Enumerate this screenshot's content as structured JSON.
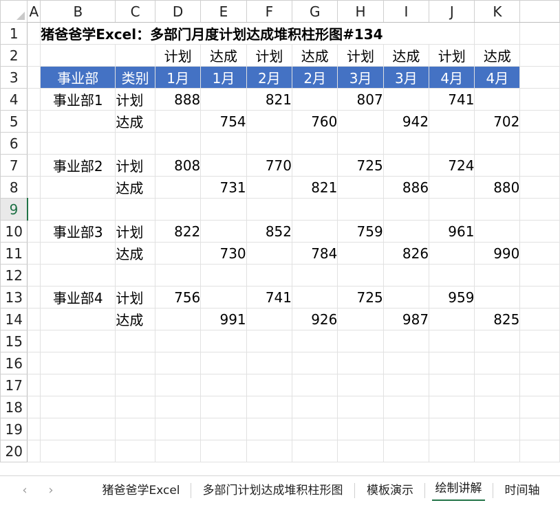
{
  "sheet": {
    "columns": [
      "A",
      "B",
      "C",
      "D",
      "E",
      "F",
      "G",
      "H",
      "I",
      "J",
      "K"
    ],
    "rows": [
      "1",
      "2",
      "3",
      "4",
      "5",
      "6",
      "7",
      "8",
      "9",
      "10",
      "11",
      "12",
      "13",
      "14",
      "15",
      "16",
      "17",
      "18",
      "19",
      "20"
    ],
    "active_row": "9",
    "title": "猪爸爸学Excel：多部门月度计划达成堆积柱形图#134",
    "row2": [
      "计划",
      "达成",
      "计划",
      "达成",
      "计划",
      "达成",
      "计划",
      "达成"
    ],
    "header_row": [
      "事业部",
      "类别",
      "1月",
      "1月",
      "2月",
      "2月",
      "3月",
      "3月",
      "4月",
      "4月"
    ],
    "departments": [
      {
        "name": "事业部1",
        "plan_label": "计划",
        "actual_label": "达成",
        "plan": [
          "888",
          "",
          "821",
          "",
          "807",
          "",
          "741",
          ""
        ],
        "actual": [
          "",
          "754",
          "",
          "760",
          "",
          "942",
          "",
          "702"
        ]
      },
      {
        "name": "事业部2",
        "plan_label": "计划",
        "actual_label": "达成",
        "plan": [
          "808",
          "",
          "770",
          "",
          "725",
          "",
          "724",
          ""
        ],
        "actual": [
          "",
          "731",
          "",
          "821",
          "",
          "886",
          "",
          "880"
        ]
      },
      {
        "name": "事业部3",
        "plan_label": "计划",
        "actual_label": "达成",
        "plan": [
          "822",
          "",
          "852",
          "",
          "759",
          "",
          "961",
          ""
        ],
        "actual": [
          "",
          "730",
          "",
          "784",
          "",
          "826",
          "",
          "990"
        ]
      },
      {
        "name": "事业部4",
        "plan_label": "计划",
        "actual_label": "达成",
        "plan": [
          "756",
          "",
          "741",
          "",
          "725",
          "",
          "959",
          ""
        ],
        "actual": [
          "",
          "991",
          "",
          "926",
          "",
          "987",
          "",
          "825"
        ]
      }
    ],
    "header_color": "#4472c4",
    "active_color": "#217346"
  },
  "tabs": {
    "prev_icon": "chevron-left-icon",
    "next_icon": "chevron-right-icon",
    "items": [
      "猪爸爸学Excel",
      "多部门计划达成堆积柱形图",
      "模板演示",
      "绘制讲解",
      "时间轴"
    ],
    "active_index": 3
  }
}
